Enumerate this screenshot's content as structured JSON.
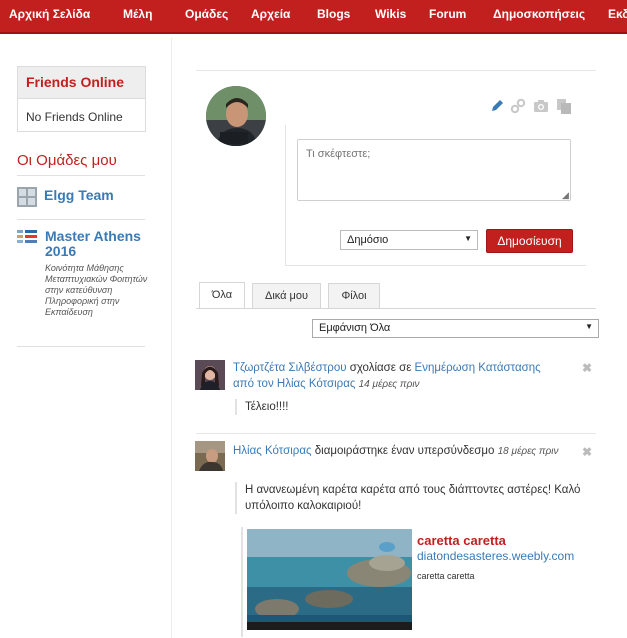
{
  "nav": {
    "items": [
      "Αρχική Σελίδα",
      "Μέλη",
      "Ομάδες",
      "Αρχεία",
      "Blogs",
      "Wikis",
      "Forum",
      "Δημοσκοπήσεις",
      "Εκδ"
    ]
  },
  "sidebar": {
    "friends_title": "Friends Online",
    "friends_empty": "No Friends Online",
    "groups_title": "Οι Ομάδες μου",
    "groups": [
      {
        "name": "Elgg Team",
        "icon": "group-logo-icon"
      },
      {
        "name": "Master Athens 2016",
        "icon": "group-logo-icon",
        "description": "Κοινότητα Μάθησης Μεταπτυχιακών Φοιτητών στην κατεύθυνση Πληροφορική στην Εκπαίδευση"
      }
    ]
  },
  "status": {
    "placeholder": "Τι σκέφτεστε;",
    "privacy_selected": "Δημόσιο",
    "post_label": "Δημοσίευση",
    "tools": [
      "pencil-icon",
      "link-icon",
      "camera-icon",
      "file-icon"
    ]
  },
  "tabs": [
    {
      "label": "Όλα",
      "active": true
    },
    {
      "label": "Δικά μου",
      "active": false
    },
    {
      "label": "Φίλοι",
      "active": false
    }
  ],
  "filter": {
    "selected": "Εμφάνιση Όλα"
  },
  "feed": [
    {
      "author": "Τζωρτζέτα Σιλβέστρου",
      "action": "σχολίασε σε",
      "target": "Ενημέρωση Κατάστασης από τον Ηλίας Κότσιρας",
      "time": "14 μέρες πριν",
      "comment": "Τέλειο!!!!"
    },
    {
      "author": "Ηλίας Κότσιρας",
      "action": "διαμοιράστηκε έναν υπερσύνδεσμο",
      "time": "18 μέρες πριν",
      "body": "Η ανανεωμένη καρέτα καρέτα από τους διάπτοντες αστέρες! Καλό υπόλοιπο καλοκαιριού!",
      "link": {
        "title": "caretta caretta",
        "domain": "diatondesasteres.weebly.com",
        "description": "caretta caretta"
      }
    }
  ],
  "colors": {
    "brand": "#c1201f",
    "link": "#3a7ab6"
  }
}
